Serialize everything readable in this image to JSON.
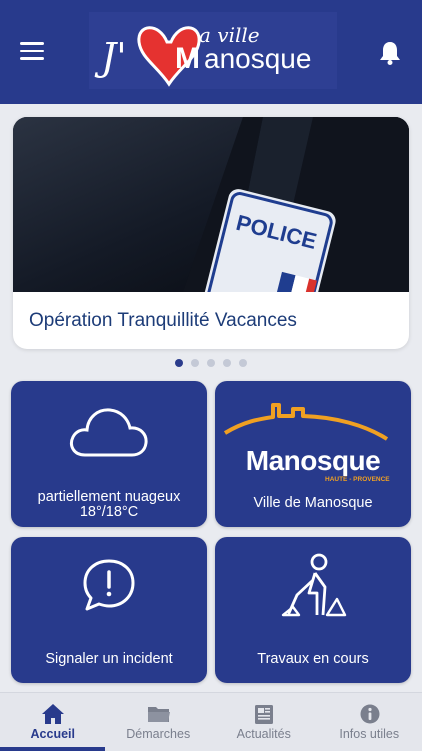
{
  "header": {
    "menu_icon": "hamburger-menu-icon",
    "logo": {
      "j": "J'",
      "small": "a ville",
      "main": "anosque",
      "m": "M"
    },
    "bell_icon": "bell-icon",
    "color": "#283a8c"
  },
  "carousel": {
    "title": "Opération Tranquillité Vacances",
    "badge_text": "POLICE",
    "dots": 5,
    "active_index": 0
  },
  "tiles": [
    {
      "label": "partiellement nuageux",
      "sublabel": "18°/18°C",
      "icon": "cloud-icon"
    },
    {
      "label": "Ville de Manosque",
      "logo_main": "Manosque",
      "logo_sub": "HAUTE - PROVENCE",
      "icon": "manosque-logo"
    },
    {
      "label": "Signaler un incident",
      "icon": "alert-chat-icon"
    },
    {
      "label": "Travaux en cours",
      "icon": "construction-worker-icon"
    }
  ],
  "tabbar": {
    "items": [
      {
        "label": "Accueil",
        "icon": "home-icon",
        "active": true
      },
      {
        "label": "Démarches",
        "icon": "folder-icon",
        "active": false
      },
      {
        "label": "Actualités",
        "icon": "newspaper-icon",
        "active": false
      },
      {
        "label": "Infos utiles",
        "icon": "info-icon",
        "active": false
      }
    ]
  }
}
